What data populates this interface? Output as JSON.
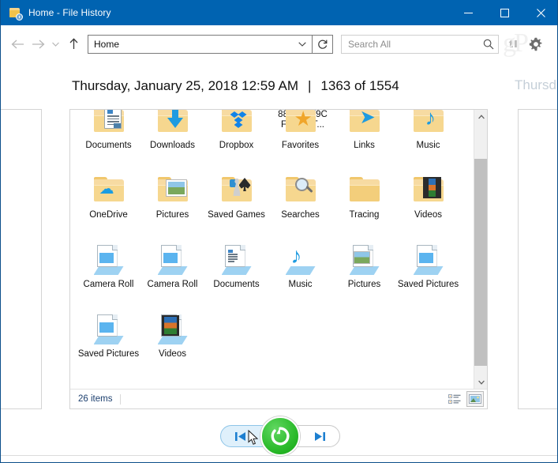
{
  "window": {
    "title": "Home - File History",
    "app_icon": "folder-history-icon",
    "minimize_label": "—",
    "maximize_label": "□",
    "close_label": "✕",
    "titlebar_color": "#0063b1"
  },
  "toolbar": {
    "back_icon": "back-arrow-icon",
    "forward_icon": "forward-arrow-icon",
    "recent_icon": "recent-locations-chevron-icon",
    "up_icon": "up-arrow-icon",
    "address_value": "Home",
    "address_chevron_icon": "chevron-down-icon",
    "refresh_icon": "refresh-icon",
    "search_placeholder": "Search All",
    "search_icon": "search-icon",
    "restore_original_icon": "restore-to-original-location-icon",
    "settings_icon": "gear-icon",
    "watermark": "gP"
  },
  "header": {
    "date": "Thursday, January 25, 2018 12:59 AM",
    "separator": "|",
    "counter": "1363 of 1554",
    "ghost_next": "Thursd"
  },
  "pane": {
    "clipped_item_line1": "8866FCF9C",
    "clipped_item_line2": "FC24C.T...",
    "items": [
      {
        "label": "Documents",
        "icon": "folder-documents-icon",
        "kind": "folder-doc"
      },
      {
        "label": "Downloads",
        "icon": "folder-downloads-icon",
        "kind": "folder-download"
      },
      {
        "label": "Dropbox",
        "icon": "folder-dropbox-icon",
        "kind": "folder-dropbox"
      },
      {
        "label": "Favorites",
        "icon": "folder-favorites-icon",
        "kind": "folder-star"
      },
      {
        "label": "Links",
        "icon": "folder-links-icon",
        "kind": "folder-link"
      },
      {
        "label": "Music",
        "icon": "folder-music-icon",
        "kind": "folder-note"
      },
      {
        "label": "OneDrive",
        "icon": "folder-onedrive-icon",
        "kind": "folder-cloud"
      },
      {
        "label": "Pictures",
        "icon": "folder-pictures-icon",
        "kind": "folder-photo"
      },
      {
        "label": "Saved Games",
        "icon": "folder-saved-games-icon",
        "kind": "folder-games"
      },
      {
        "label": "Searches",
        "icon": "folder-searches-icon",
        "kind": "folder-search"
      },
      {
        "label": "Tracing",
        "icon": "folder-plain-icon",
        "kind": "folder-plain"
      },
      {
        "label": "Videos",
        "icon": "folder-videos-icon",
        "kind": "folder-film"
      },
      {
        "label": "Camera Roll",
        "icon": "library-camera-roll-icon",
        "kind": "lib-pic"
      },
      {
        "label": "Camera Roll",
        "icon": "library-camera-roll-icon",
        "kind": "lib-pic"
      },
      {
        "label": "Documents",
        "icon": "library-documents-icon",
        "kind": "lib-doc"
      },
      {
        "label": "Music",
        "icon": "library-music-icon",
        "kind": "lib-note"
      },
      {
        "label": "Pictures",
        "icon": "library-pictures-icon",
        "kind": "lib-photo"
      },
      {
        "label": "Saved Pictures",
        "icon": "library-saved-pictures-icon",
        "kind": "lib-pic"
      },
      {
        "label": "Saved Pictures",
        "icon": "library-saved-pictures-icon",
        "kind": "lib-pic"
      },
      {
        "label": "Videos",
        "icon": "library-videos-icon",
        "kind": "lib-film"
      }
    ],
    "scroll_up_icon": "scroll-up-arrow-icon",
    "scroll_down_icon": "scroll-down-arrow-icon"
  },
  "status": {
    "item_count": "26 items",
    "details_view_icon": "details-view-icon",
    "large-icons_view_icon": "large-icons-view-icon",
    "selected_view": "large-icons"
  },
  "controls": {
    "previous_icon": "previous-version-icon",
    "previous_label": "⏮",
    "restore_icon": "restore-circular-arrow-icon",
    "next_icon": "next-version-icon",
    "next_label": "⏭",
    "restore_color": "#2fbd2f",
    "prev_hover": true,
    "cursor_icon": "mouse-cursor-icon"
  }
}
